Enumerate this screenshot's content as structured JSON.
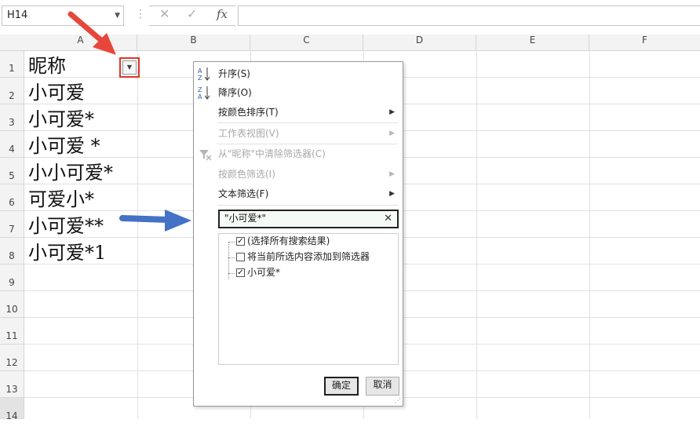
{
  "formula_bar": {
    "name_box": "H14",
    "cancel_icon": "✕",
    "enter_icon": "✓",
    "fx_label": "fx",
    "formula": ""
  },
  "columns": [
    "A",
    "B",
    "C",
    "D",
    "E",
    "F"
  ],
  "rows": [
    "1",
    "2",
    "3",
    "4",
    "5",
    "6",
    "7",
    "8",
    "9",
    "10",
    "11",
    "12",
    "13",
    "14"
  ],
  "cells": {
    "a1": "昵称",
    "a2": "小可爱",
    "a3": "小可爱*",
    "a4": "小可爱 *",
    "a5": "小小可爱*",
    "a6": "可爱小*",
    "a7": "小可爱**",
    "a8": "小可爱*1"
  },
  "filter_menu": {
    "sort_asc": "升序(S)",
    "sort_desc": "降序(O)",
    "sort_by_color": "按颜色排序(T)",
    "sheet_view": "工作表视图(V)",
    "clear_filter": "从\"昵称\"中清除筛选器(C)",
    "filter_by_color": "按颜色筛选(I)",
    "text_filter": "文本筛选(F)",
    "search_value": "\"小可爱*\"",
    "list": {
      "select_all": "(选择所有搜索结果)",
      "add_to_filter": "将当前所选内容添加到筛选器",
      "item1": "小可爱*"
    },
    "ok": "确定",
    "cancel": "取消"
  },
  "colors": {
    "highlight_box": "#e0352b",
    "red_arrow": "#e8463a",
    "blue_arrow": "#4472c4"
  }
}
